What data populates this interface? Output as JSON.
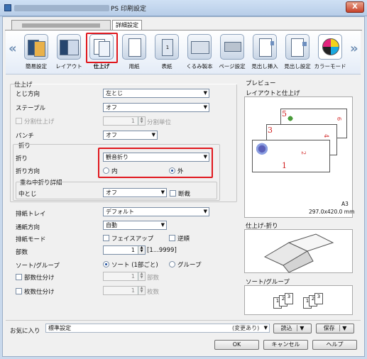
{
  "window": {
    "title": "PS 印刷設定",
    "close": "X"
  },
  "tabs": {
    "detail": "詳細設定"
  },
  "toolbar": {
    "items": [
      {
        "label": "簡易設定",
        "icon": "quick-setup-icon"
      },
      {
        "label": "レイアウト",
        "icon": "layout-icon"
      },
      {
        "label": "仕上げ",
        "icon": "finishing-icon"
      },
      {
        "label": "用紙",
        "icon": "paper-icon"
      },
      {
        "label": "表紙",
        "icon": "cover-icon"
      },
      {
        "label": "くるみ製本",
        "icon": "perfect-binding-icon"
      },
      {
        "label": "ページ設定",
        "icon": "page-setup-icon"
      },
      {
        "label": "見出し挿入",
        "icon": "tab-insert-icon"
      },
      {
        "label": "見出し設定",
        "icon": "tab-setup-icon"
      },
      {
        "label": "カラーモード",
        "icon": "color-mode-icon"
      }
    ]
  },
  "finishing": {
    "section": "仕上げ",
    "binding_label": "とじ方向",
    "binding_value": "左とじ",
    "staple_label": "ステープル",
    "staple_value": "オフ",
    "split_label": "分割仕上げ",
    "split_value": "1",
    "split_unit": "分割単位",
    "punch_label": "パンチ",
    "punch_value": "オフ",
    "fold_group": "折り",
    "fold_label": "折り",
    "fold_value": "観音折り",
    "fold_dir_label": "折り方向",
    "fold_in": "内",
    "fold_out": "外",
    "saddle_group": "重ね中折り詳細",
    "saddle_label": "中とじ",
    "saddle_value": "オフ",
    "trim_label": "断裁"
  },
  "output": {
    "tray_label": "排紙トレイ",
    "tray_value": "デフォルト",
    "dir_label": "通紙方向",
    "dir_value": "自動",
    "mode_label": "排紙モード",
    "faceup": "フェイスアップ",
    "reverse": "逆順",
    "copies_label": "部数",
    "copies_value": "1",
    "copies_range": "[1...9999]",
    "sort_label": "ソート/グループ",
    "sort": "ソート (1部ごと)",
    "group": "グループ",
    "offset_label": "部数仕分け",
    "offset_value": "1",
    "offset_unit": "部数",
    "sheets_label": "枚数仕分け",
    "sheets_value": "1",
    "sheets_unit": "枚数"
  },
  "preview": {
    "title": "プレビュー",
    "layout_title": "レイアウトと仕上げ",
    "page_numbers": [
      "5",
      "6",
      "3",
      "4",
      "1",
      "2"
    ],
    "paper_name": "A3",
    "paper_size": "297.0x420.0 mm",
    "fold_title": "仕上げ-折り",
    "sort_title": "ソート/グループ",
    "stack_pages": [
      "1",
      "2",
      "3"
    ]
  },
  "footer": {
    "favorite_label": "お気に入り",
    "favorite_value": "標準設定",
    "changed": "(変更あり)",
    "load": "読込",
    "save": "保存",
    "ok": "OK",
    "cancel": "キャンセル",
    "help": "ヘルプ"
  },
  "colors": {
    "highlight": "#e0171d",
    "titlebar": "#b7cde8",
    "accent": "#1e4fa0"
  }
}
